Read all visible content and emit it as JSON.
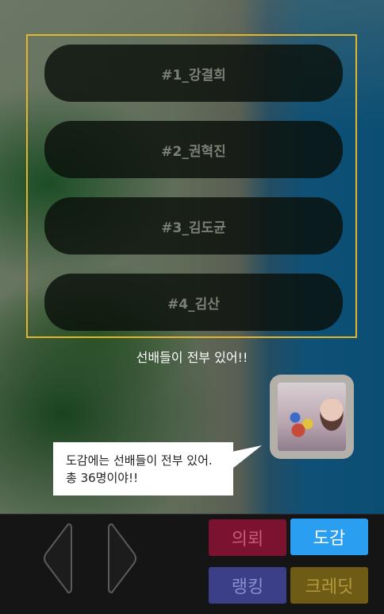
{
  "list": {
    "items": [
      {
        "label": "#1_강결희"
      },
      {
        "label": "#2_권혁진"
      },
      {
        "label": "#3_김도균"
      },
      {
        "label": "#4_김산"
      }
    ]
  },
  "caption": "선배들이 전부 있어!!",
  "bubble": {
    "line1": "도감에는 선배들이 전부 있어.",
    "line2": "총 36명이야!!"
  },
  "nav": {
    "prev_icon": "chevron-left-icon",
    "next_icon": "chevron-right-icon"
  },
  "menu": {
    "request": {
      "label": "의뢰",
      "color": "#7a1230",
      "text_color": "#c65a76"
    },
    "encyclopedia": {
      "label": "도감",
      "color": "#2a9ef0",
      "text_color": "#ffffff"
    },
    "ranking": {
      "label": "랭킹",
      "color": "#3a3f88",
      "text_color": "#8a8fd0"
    },
    "credit": {
      "label": "크레딧",
      "color": "#6e5c16",
      "text_color": "#b49a3a"
    }
  },
  "colors": {
    "frame": "#e3b52c"
  }
}
